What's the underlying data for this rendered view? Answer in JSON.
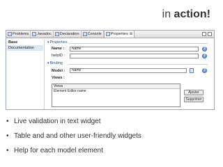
{
  "slide": {
    "title_plain": "in",
    "title_bold": "action!",
    "bullets": [
      "Live validation in text widget",
      "Table and and other user-friendly widgets",
      "Help for each model element"
    ]
  },
  "window": {
    "tabs": [
      {
        "label": "Problems",
        "active": false
      },
      {
        "label": "Javadoc",
        "active": false
      },
      {
        "label": "Declaration",
        "active": false
      },
      {
        "label": "Console",
        "active": false
      },
      {
        "label": "Properties",
        "active": true
      }
    ],
    "tab_close_glyph": "⊠"
  },
  "sidebar": {
    "items": [
      {
        "label": "Base",
        "bold": true
      },
      {
        "label": "Documentation",
        "bold": false
      }
    ]
  },
  "properties_section": {
    "header": "Properties",
    "name_label": "Name :",
    "name_value": "Name",
    "helpid_label": "helpID :",
    "helpid_value": ""
  },
  "binding_section": {
    "header": "Binding",
    "model_label": "Model :",
    "model_value": "Name",
    "views_label": "Views :",
    "views_column": "Views",
    "views_rows": [
      "Element Editor name"
    ]
  },
  "buttons": {
    "add": "Ajouter",
    "remove": "Supprimer"
  },
  "icons": {
    "help": "?"
  },
  "colors": {
    "section_header": "#2b4d86",
    "selection": "#dbe6f6",
    "help_icon": "#7fa2d8"
  }
}
